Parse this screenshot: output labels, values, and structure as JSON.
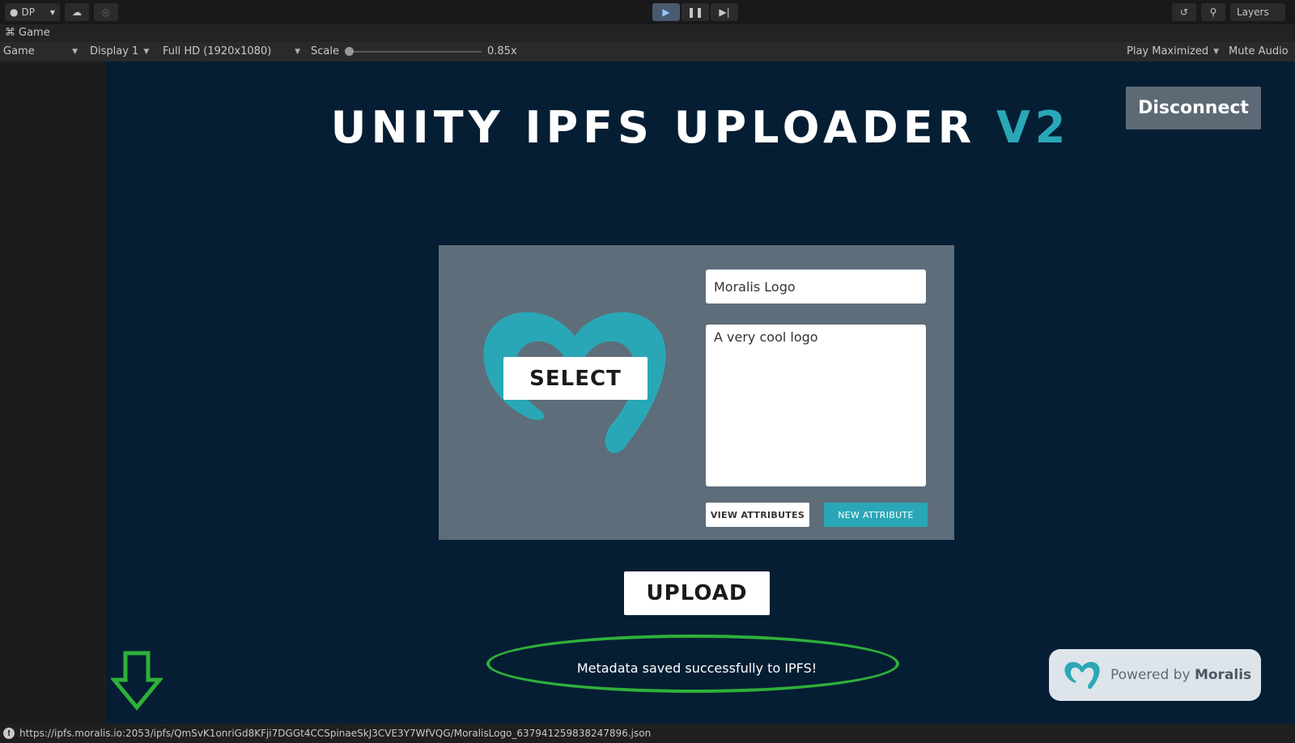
{
  "toolbar": {
    "account_label": "DP",
    "layers_label": "Layers",
    "icons": [
      "account-icon",
      "cloud-icon",
      "collab-icon",
      "play-icon",
      "pause-icon",
      "step-icon",
      "history-icon",
      "search-icon"
    ]
  },
  "tab": {
    "label": "Game"
  },
  "viewbar": {
    "mode": "Game",
    "display": "Display 1",
    "resolution": "Full HD (1920x1080)",
    "scale_label": "Scale",
    "scale_value": "0.85x",
    "play_maximized": "Play Maximized",
    "mute_audio": "Mute Audio"
  },
  "game": {
    "title_main": "UNITY IPFS UPLOADER",
    "title_accent": "V2",
    "disconnect_label": "Disconnect",
    "select_label": "SELECT",
    "name_value": "Moralis Logo",
    "description_value": "A very cool logo",
    "view_attributes_label": "VIEW ATTRIBUTES",
    "new_attribute_label": "NEW ATTRIBUTE",
    "upload_label": "UPLOAD",
    "status_message": "Metadata saved successfully to IPFS!",
    "powered_by_prefix": "Powered by",
    "powered_by_brand": "Moralis",
    "accent_color": "#2aa7b6",
    "highlight_color": "#2fb03a"
  },
  "statusbar": {
    "message": "https://ipfs.moralis.io:2053/ipfs/QmSvK1onriGd8KFji7DGGt4CCSpinaeSkJ3CVE3Y7WfVQG/MoralisLogo_637941259838247896.json"
  }
}
